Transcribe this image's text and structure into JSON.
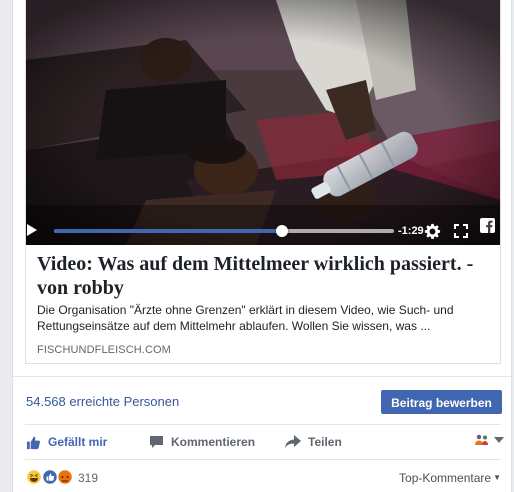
{
  "video": {
    "time_remaining": "-1:29",
    "progress": 0.67
  },
  "preview": {
    "title": "Video: Was auf dem Mittelmeer wirklich passiert. - von robby",
    "description": "Die Organisation \"Ärzte ohne Grenzen\" erklärt in diesem Video, wie Such- und Rettungseinsätze auf dem Mittelmehr ablaufen. Wollen Sie wissen, was ...",
    "domain": "FISCHUNDFLEISCH.COM"
  },
  "insights": {
    "reach": "54.568 erreichte Personen",
    "boost_label": "Beitrag bewerben"
  },
  "actions": {
    "like": "Gefällt mir",
    "comment": "Kommentieren",
    "share": "Teilen"
  },
  "reactions": {
    "count": "319",
    "sort_label": "Top-Kommentare",
    "icons": [
      "haha-icon",
      "like-icon",
      "angry-icon"
    ]
  },
  "colors": {
    "accent": "#4267b2",
    "link": "#365899",
    "muted": "#606770"
  }
}
